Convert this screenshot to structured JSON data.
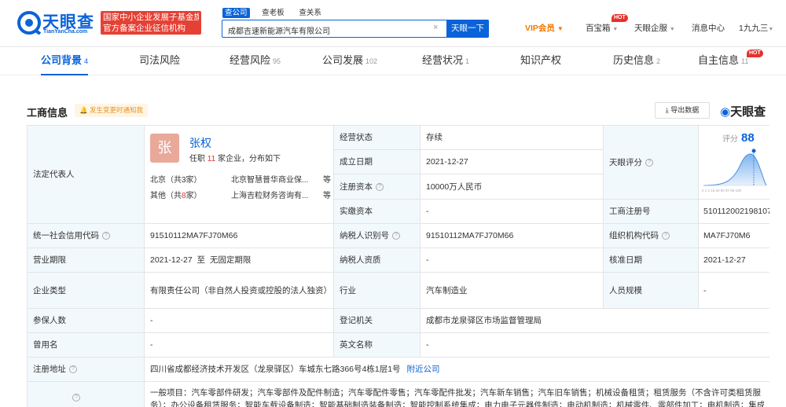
{
  "header": {
    "logo_name": "天眼查",
    "logo_url": "TianYanCha.com",
    "badge_line1": "国家中小企业发展子基金旗下",
    "badge_line2": "官方备案企业征信机构",
    "search_tabs": [
      "查公司",
      "查老板",
      "查关系"
    ],
    "search_value": "成都吉速新能源汽车有限公司",
    "search_button": "天眼一下",
    "clear_glyph": "×",
    "nav": {
      "vip": "VIP会员",
      "baibao": "百宝箱",
      "qiyuan": "天眼企服",
      "msg": "消息中心",
      "user": "1九九三"
    },
    "hot_label": "HOT"
  },
  "tabs": [
    {
      "label": "公司背景",
      "count": "4"
    },
    {
      "label": "司法风险",
      "count": ""
    },
    {
      "label": "经营风险",
      "count": "95"
    },
    {
      "label": "公司发展",
      "count": "102"
    },
    {
      "label": "经营状况",
      "count": "1"
    },
    {
      "label": "知识产权",
      "count": ""
    },
    {
      "label": "历史信息",
      "count": "2"
    },
    {
      "label": "自主信息",
      "count": "11"
    }
  ],
  "section": {
    "title": "工商信息",
    "notice": "发生变更时通知我",
    "export": "导出数据",
    "watermark": "天眼查"
  },
  "rep": {
    "label": "法定代表人",
    "avatar": "张",
    "name": "张权",
    "sum_pre": "任职",
    "sum_num": "11",
    "sum_post": "家企业，分布如下",
    "row1_city": "北京（共3家）",
    "row1_comp": "北京智慧普华商业保...",
    "row2_city_pre": "其他（共",
    "row2_num": "8",
    "row2_city_post": "家）",
    "row2_comp": "上海吉粒财务咨询有...",
    "etc": "等"
  },
  "info": {
    "status_label": "经营状态",
    "status": "存续",
    "estab_label": "成立日期",
    "estab": "2021-12-27",
    "capital_label": "注册资本",
    "capital": "10000万人民币",
    "paid_label": "实缴资本",
    "paid": "-",
    "score_label": "天眼评分",
    "score_text": "评分",
    "score_value": "88",
    "score_ticks": "0 1 3 15 60 80 97 99 100",
    "regno_label": "工商注册号",
    "regno": "510112002198107",
    "uscc_label": "统一社会信用代码",
    "uscc": "91510112MA7FJ70M66",
    "taxid_label": "纳税人识别号",
    "taxid": "91510112MA7FJ70M66",
    "org_label": "组织机构代码",
    "org": "MA7FJ70M6",
    "term_label": "营业期限",
    "term": "2021-12-27  至  无固定期限",
    "taxq_label": "纳税人资质",
    "taxq": "-",
    "approve_label": "核准日期",
    "approve": "2021-12-27",
    "type_label": "企业类型",
    "type": "有限责任公司（非自然人投资或控股的法人独资）",
    "industry_label": "行业",
    "industry": "汽车制造业",
    "staff_label": "人员规模",
    "staff": "-",
    "insured_label": "参保人数",
    "insured": "-",
    "authority_label": "登记机关",
    "authority": "成都市龙泉驿区市场监督管理局",
    "former_label": "曾用名",
    "former": "-",
    "english_label": "英文名称",
    "english": "-",
    "addr_label": "注册地址",
    "addr": "四川省成都经济技术开发区（龙泉驿区）车城东七路366号4栋1层1号",
    "addr_link": "附近公司",
    "scope_text1": "一般项目：汽车零部件研发；汽车零部件及配件制造；汽车零配件零售；汽车零配件批发；汽车新车销售；汽车旧车销售；机械设备租赁；租赁服务（不含许可类租赁服",
    "scope_text2": "务）；办公设备租赁服务；智能车载设备制造；智能基础制造装备制造；智能控制系统集成；电力电子元器件制造；电动机制造；机械零件、零部件加工；电机制造；集成"
  },
  "colors": {
    "brand": "#0a63d8",
    "badge": "#e54034",
    "vip": "#f07800",
    "hot": "#e5322d",
    "label_bg": "#f2f9fc"
  }
}
